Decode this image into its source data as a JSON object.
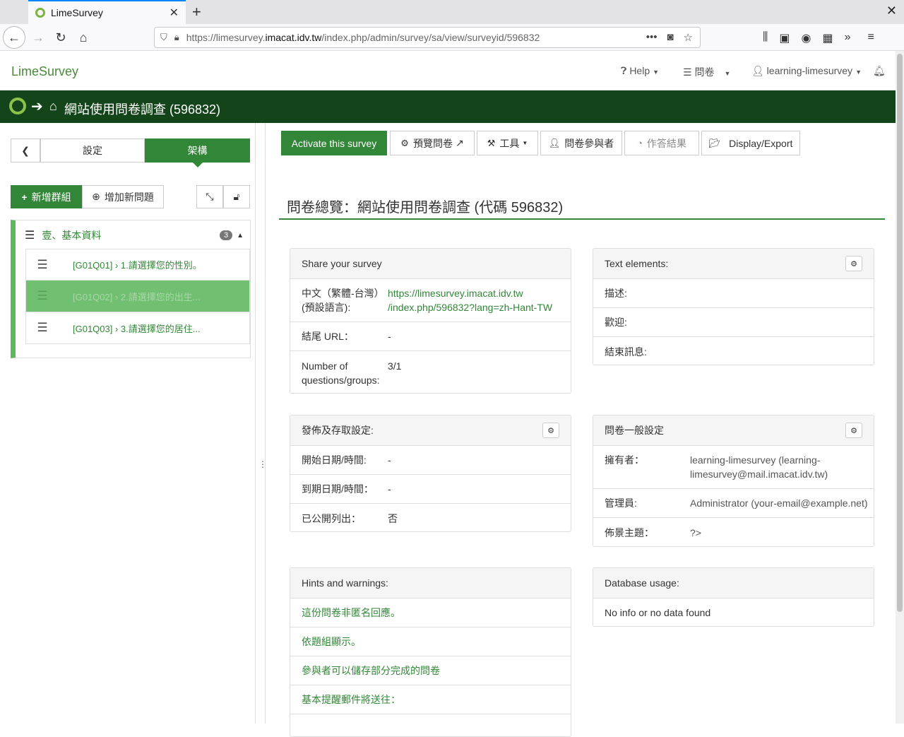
{
  "browser": {
    "tab_title": "LimeSurvey",
    "url_prefix": "https://limesurvey.",
    "url_domain": "imacat.idv.tw",
    "url_path": "/index.php/admin/survey/sa/view/surveyid/596832",
    "url_more": "•••"
  },
  "topbar": {
    "brand": "LimeSurvey",
    "help": "Help",
    "surveys": "問卷",
    "user": "learning-limesurvey"
  },
  "titlebar": {
    "title": "網站使用問卷調查 (596832)"
  },
  "sidebar": {
    "tab_settings": "設定",
    "tab_structure": "架構",
    "add_group": "新增群組",
    "add_question": "增加新問題",
    "group": {
      "name": "壹、基本資料",
      "count": "3"
    },
    "questions": [
      {
        "label": "[G01Q01] › 1.請選擇您的性別。"
      },
      {
        "label": "[G01Q02] › 2.請選擇您的出生..."
      },
      {
        "label": "[G01Q03] › 3.請選擇您的居住..."
      }
    ]
  },
  "toolbar": {
    "activate": "Activate this survey",
    "preview": "預覽問卷",
    "tools": "工具",
    "participants": "問卷參與者",
    "responses": "作答結果",
    "display_export": "Display/Export"
  },
  "main": {
    "heading": "問卷總覽：網站使用問卷調查 (代碼 596832)"
  },
  "share_panel": {
    "title": "Share your survey",
    "lang_label_1": "中文（繁體-台灣）",
    "lang_label_2": "(預設語言):",
    "link_1": "https://limesurvey.imacat.idv.tw",
    "link_2": "/index.php/596832?lang=zh-Hant-TW",
    "end_url_label": "結尾 URL：",
    "end_url_value": "-",
    "count_label_1": "Number of",
    "count_label_2": "questions/groups:",
    "count_value": "3/1"
  },
  "text_panel": {
    "title": "Text elements:",
    "rows": [
      {
        "label": "描述:"
      },
      {
        "label": "歡迎:"
      },
      {
        "label": "結束訊息:"
      }
    ]
  },
  "publish_panel": {
    "title": "發佈及存取設定:",
    "rows": [
      {
        "label": "開始日期/時間:",
        "value": "-"
      },
      {
        "label": "到期日期/時間：",
        "value": "-"
      },
      {
        "label": "已公開列出：",
        "value": "否"
      }
    ]
  },
  "general_panel": {
    "title": "問卷一般設定",
    "owner_label": "擁有者：",
    "owner_value_1": "learning-limesurvey (learning-",
    "owner_value_2": "limesurvey@mail.imacat.idv.tw)",
    "admin_label": "管理員:",
    "admin_value": "Administrator (your-email@example.net)",
    "theme_label": "佈景主題：",
    "theme_value": "?>"
  },
  "hints_panel": {
    "title": "Hints and warnings:",
    "items": [
      "這份問卷非匿名回應。",
      "依題組顯示。",
      "參與者可以儲存部分完成的問卷",
      "基本提醒郵件將送往："
    ]
  },
  "db_panel": {
    "title": "Database usage:",
    "value": "No info or no data found"
  }
}
